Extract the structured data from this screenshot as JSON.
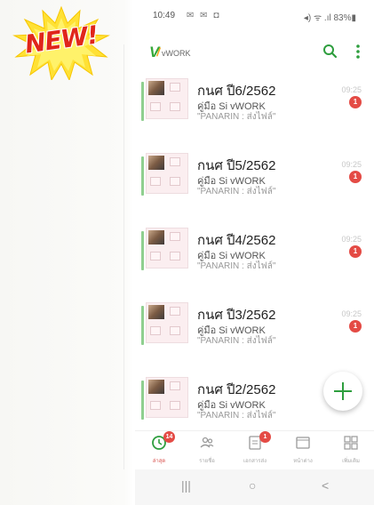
{
  "badge": {
    "text": "NEW!"
  },
  "status_bar": {
    "time": "10:49",
    "notification_icons": "✉ ✉ ◘",
    "system": "◂) ᯤ .ıl 83%▮"
  },
  "app": {
    "logo_text": "vWORK",
    "logo_mark": "V",
    "icons": {
      "search": "search-icon",
      "more": "more-vert-icon"
    }
  },
  "conversations": [
    {
      "title": "กนศ ปี6/2562",
      "subtitle": "คู่มือ Si vWORK",
      "snippet": "\"PANARIN : ส่งไฟล์\"",
      "time": "09:25",
      "unread": "1"
    },
    {
      "title": "กนศ ปี5/2562",
      "subtitle": "คู่มือ Si vWORK",
      "snippet": "\"PANARIN : ส่งไฟล์\"",
      "time": "09:25",
      "unread": "1"
    },
    {
      "title": "กนศ ปี4/2562",
      "subtitle": "คู่มือ Si vWORK",
      "snippet": "\"PANARIN : ส่งไฟล์\"",
      "time": "09:25",
      "unread": "1"
    },
    {
      "title": "กนศ ปี3/2562",
      "subtitle": "คู่มือ Si vWORK",
      "snippet": "\"PANARIN : ส่งไฟล์\"",
      "time": "09:25",
      "unread": "1"
    },
    {
      "title": "กนศ ปี2/2562",
      "subtitle": "คู่มือ Si vWORK",
      "snippet": "\"PANARIN : ส่งไฟล์\"",
      "time": "",
      "unread": ""
    }
  ],
  "fab": {
    "icon": "plus-icon"
  },
  "bottom_nav": [
    {
      "label": "ล่าสุด",
      "icon": "clock-icon",
      "badge": "14"
    },
    {
      "label": "รายชื่อ",
      "icon": "contacts-icon",
      "badge": ""
    },
    {
      "label": "เอกสารส่ง",
      "icon": "document-icon",
      "badge": "1"
    },
    {
      "label": "หน้าต่าง",
      "icon": "window-icon",
      "badge": ""
    },
    {
      "label": "เพิ่มเติม",
      "icon": "grid-icon",
      "badge": ""
    }
  ],
  "system_nav": {
    "recent": "|||",
    "home": "○",
    "back": "<"
  },
  "colors": {
    "accent_green": "#2e9e3e",
    "badge_red": "#e44b45",
    "new_red": "#e0261b",
    "star_yellow": "#ffe135"
  }
}
